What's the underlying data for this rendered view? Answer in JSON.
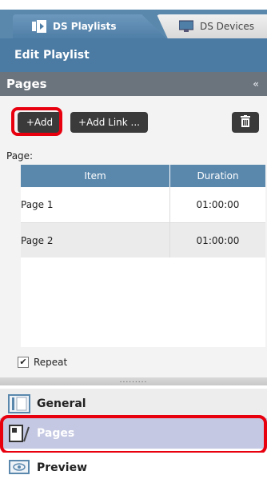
{
  "tabs": [
    {
      "label": "DS Playlists",
      "active": true
    },
    {
      "label": "DS Devices",
      "active": false
    }
  ],
  "subheader": {
    "title": "Edit Playlist"
  },
  "pages_panel": {
    "title": "Pages",
    "collapse_glyph": "«",
    "toolbar": {
      "add_label": "+Add",
      "add_link_label": "+Add Link ...",
      "delete_icon": "trash-icon"
    },
    "page_label": "Page:",
    "table": {
      "columns": [
        "Item",
        "Duration"
      ],
      "rows": [
        {
          "item": "Page 1",
          "duration": "01:00:00"
        },
        {
          "item": "Page 2",
          "duration": "01:00:00"
        }
      ]
    },
    "repeat": {
      "label": "Repeat",
      "checked": true
    }
  },
  "splitter": {
    "grip": "........."
  },
  "nav": {
    "general": "General",
    "pages": "Pages",
    "preview": "Preview"
  },
  "colors": {
    "highlight": "#e8000f",
    "accent": "#5a88ad",
    "dark_button": "#3a3a3a"
  }
}
